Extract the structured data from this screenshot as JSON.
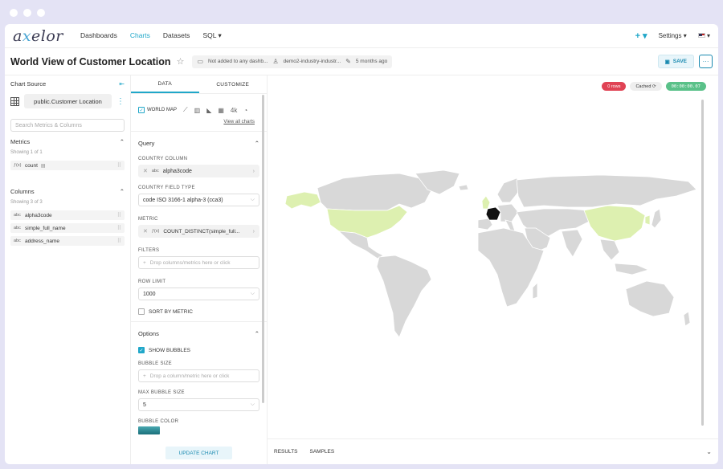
{
  "nav": {
    "logo_prefix": "a",
    "logo_x": "x",
    "logo_suffix": "elor",
    "links": [
      "Dashboards",
      "Charts",
      "Datasets",
      "SQL ▾"
    ],
    "plus": "+ ▾",
    "settings": "Settings ▾",
    "lang": "▾"
  },
  "header": {
    "title": "World View of Customer Location",
    "dashboards": "Not added to any dashb...",
    "owner": "demo2-industry-industr...",
    "modified": "5 months ago",
    "save": "SAVE",
    "more": "···"
  },
  "datasource": {
    "heading": "Chart Source",
    "name": "public.Customer Location",
    "search_placeholder": "Search Metrics & Columns",
    "metrics_heading": "Metrics",
    "metrics_showing": "Showing 1 of 1",
    "metrics": [
      {
        "type": "ƒ(x)",
        "name": "count"
      }
    ],
    "columns_heading": "Columns",
    "columns_showing": "Showing 3 of 3",
    "columns": [
      {
        "type": "abc",
        "name": "alpha3code"
      },
      {
        "type": "abc",
        "name": "simple_full_name"
      },
      {
        "type": "abc",
        "name": "address_name"
      }
    ]
  },
  "control": {
    "tab_data": "DATA",
    "tab_customize": "CUSTOMIZE",
    "viz_type": "WORLD MAP",
    "viz_4k": "4k",
    "view_all": "View all charts",
    "query_heading": "Query",
    "country_column_label": "COUNTRY COLUMN",
    "country_column_type": "abc",
    "country_column_value": "alpha3code",
    "country_field_type_label": "COUNTRY FIELD TYPE",
    "country_field_type_value": "code ISO 3166-1 alpha-3 (cca3)",
    "metric_label": "METRIC",
    "metric_type": "ƒ(x)",
    "metric_value": "COUNT_DISTINCT(simple_full...",
    "filters_label": "FILTERS",
    "filters_placeholder": "Drop columns/metrics here or click",
    "row_limit_label": "ROW LIMIT",
    "row_limit_value": "1000",
    "sort_by_metric": "SORT BY METRIC",
    "options_heading": "Options",
    "show_bubbles": "SHOW BUBBLES",
    "bubble_size_label": "BUBBLE SIZE",
    "bubble_size_placeholder": "Drop a column/metric here or click",
    "max_bubble_size_label": "MAX BUBBLE SIZE",
    "max_bubble_size_value": "5",
    "bubble_color_label": "BUBBLE COLOR",
    "update": "UPDATE CHART"
  },
  "status": {
    "rows": "0 rows",
    "cached": "Cached",
    "timer": "00:00:00.07"
  },
  "results": {
    "tab_results": "RESULTS",
    "tab_samples": "SAMPLES"
  },
  "colors": {
    "accent": "#20a7c9",
    "highlight_country": "#ddf0b0",
    "selected_country": "#111111",
    "land": "#d8d8d8"
  }
}
